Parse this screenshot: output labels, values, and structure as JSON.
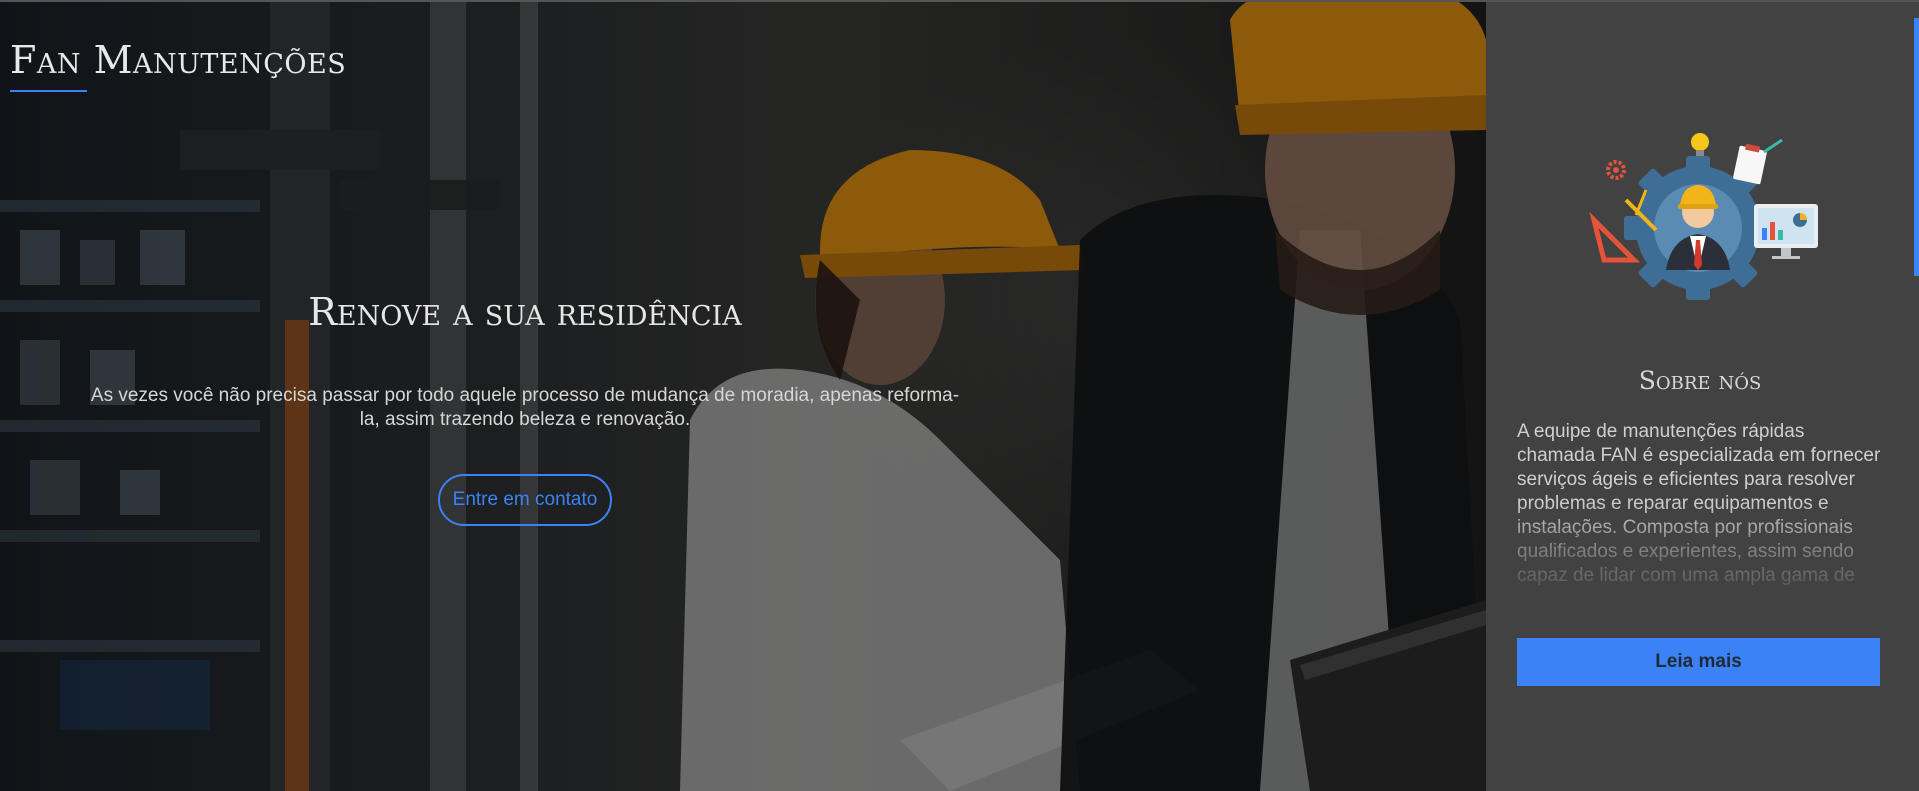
{
  "brand": {
    "name": "Fan Manutenções"
  },
  "hero": {
    "title": "Renove a sua residência",
    "text": "As vezes você não precisa passar por todo aquele processo de mudança de moradia, apenas reforma-la, assim trazendo beleza e renovação.",
    "cta_label": "Entre em contato"
  },
  "about": {
    "title": "Sobre nós",
    "text": "A equipe de manutenções rápidas chamada FAN é especializada em fornecer serviços ágeis e eficientes para resolver problemas e reparar equipamentos e instalações. Composta por profissionais qualificados e experientes, assim sendo capaz de lidar com uma ampla gama de",
    "read_more_label": "Leia mais"
  },
  "colors": {
    "accent": "#3b82f6",
    "sidebar_bg": "#424242"
  }
}
